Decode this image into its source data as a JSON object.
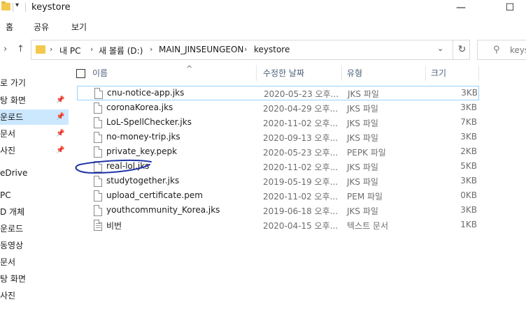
{
  "window": {
    "title": "keystore",
    "minimize_glyph": "—",
    "maximize_glyph": "☐"
  },
  "ribbon": {
    "tabs": [
      "홈",
      "공유",
      "보기"
    ]
  },
  "address": {
    "segments": [
      "내 PC",
      "새 볼륨 (D:)",
      "MAIN_JINSEUNGEON",
      "keystore"
    ],
    "search_placeholder": "keys"
  },
  "nav": {
    "items": [
      {
        "label": "로 가기",
        "pinned": false,
        "selected": false
      },
      {
        "label": "탕 화면",
        "pinned": true,
        "selected": false
      },
      {
        "label": "운로드",
        "pinned": true,
        "selected": true
      },
      {
        "label": "문서",
        "pinned": true,
        "selected": false
      },
      {
        "label": "사진",
        "pinned": true,
        "selected": false
      },
      {
        "label": "eDrive",
        "pinned": false,
        "selected": false
      },
      {
        "label": "PC",
        "pinned": false,
        "selected": false
      },
      {
        "label": "D 개체",
        "pinned": false,
        "selected": false
      },
      {
        "label": "운로드",
        "pinned": false,
        "selected": false
      },
      {
        "label": "동영상",
        "pinned": false,
        "selected": false
      },
      {
        "label": "문서",
        "pinned": false,
        "selected": false
      },
      {
        "label": "탕 화면",
        "pinned": false,
        "selected": false
      },
      {
        "label": "사진",
        "pinned": false,
        "selected": false
      }
    ]
  },
  "columns": {
    "name": "이름",
    "date": "수정한 날짜",
    "type": "유형",
    "size": "크기"
  },
  "files": [
    {
      "name": "cnu-notice-app.jks",
      "date": "2020-05-23 오후...",
      "type": "JKS 파일",
      "size": "3KB",
      "icon": "file-icon"
    },
    {
      "name": "coronaKorea.jks",
      "date": "2020-04-29 오후...",
      "type": "JKS 파일",
      "size": "3KB",
      "icon": "file-icon"
    },
    {
      "name": "LoL-SpellChecker.jks",
      "date": "2020-11-02 오후...",
      "type": "JKS 파일",
      "size": "7KB",
      "icon": "file-icon"
    },
    {
      "name": "no-money-trip.jks",
      "date": "2020-09-13 오후...",
      "type": "JKS 파일",
      "size": "3KB",
      "icon": "file-icon"
    },
    {
      "name": "private_key.pepk",
      "date": "2020-05-23 오후...",
      "type": "PEPK 파일",
      "size": "2KB",
      "icon": "file-icon"
    },
    {
      "name": "real-lol.jks",
      "date": "2020-11-02 오후...",
      "type": "JKS 파일",
      "size": "5KB",
      "icon": "file-icon"
    },
    {
      "name": "studytogether.jks",
      "date": "2019-05-19 오후...",
      "type": "JKS 파일",
      "size": "3KB",
      "icon": "file-icon"
    },
    {
      "name": "upload_certificate.pem",
      "date": "2020-11-02 오후...",
      "type": "PEM 파일",
      "size": "0KB",
      "icon": "file-icon"
    },
    {
      "name": "youthcommunity_Korea.jks",
      "date": "2019-06-18 오후...",
      "type": "JKS 파일",
      "size": "3KB",
      "icon": "file-icon"
    },
    {
      "name": "비번",
      "date": "2020-04-15 오후...",
      "type": "텍스트 문서",
      "size": "1KB",
      "icon": "text-file-icon"
    }
  ],
  "colors": {
    "selection": "#cce8ff",
    "hover_border": "#99d1ff",
    "annotation_ink": "#1f35a8",
    "folder": "#f2c94c"
  }
}
